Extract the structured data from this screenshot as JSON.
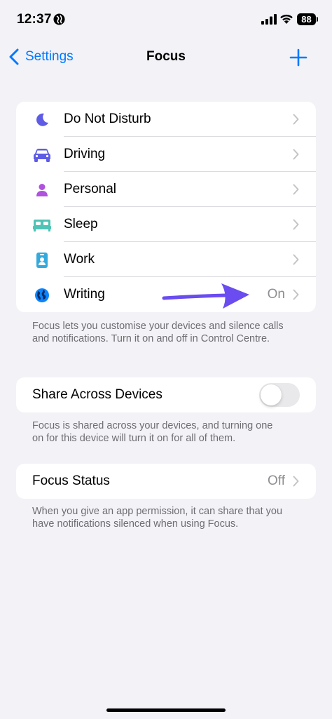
{
  "status_bar": {
    "time": "12:37",
    "battery": "88"
  },
  "nav": {
    "back_label": "Settings",
    "title": "Focus"
  },
  "focus_modes": [
    {
      "label": "Do Not Disturb",
      "icon": "moon-icon",
      "color": "#5e5ce6"
    },
    {
      "label": "Driving",
      "icon": "car-icon",
      "color": "#5e5ce6"
    },
    {
      "label": "Personal",
      "icon": "person-icon",
      "color": "#af52de"
    },
    {
      "label": "Sleep",
      "icon": "bed-icon",
      "color": "#4fc3b5"
    },
    {
      "label": "Work",
      "icon": "id-badge-icon",
      "color": "#34aadc"
    },
    {
      "label": "Writing",
      "icon": "globe-icon",
      "color": "#0a84ff",
      "value": "On"
    }
  ],
  "focus_footer": "Focus lets you customise your devices and silence calls and notifications. Turn it on and off in Control Centre.",
  "share_across_devices": {
    "label": "Share Across Devices",
    "enabled": false,
    "footer": "Focus is shared across your devices, and turning one on for this device will turn it on for all of them."
  },
  "focus_status": {
    "label": "Focus Status",
    "value": "Off",
    "footer": "When you give an app permission, it can share that you have notifications silenced when using Focus."
  },
  "colors": {
    "accent": "#007aff",
    "annotation_arrow": "#6a4cf0",
    "background": "#f2f2f7"
  }
}
